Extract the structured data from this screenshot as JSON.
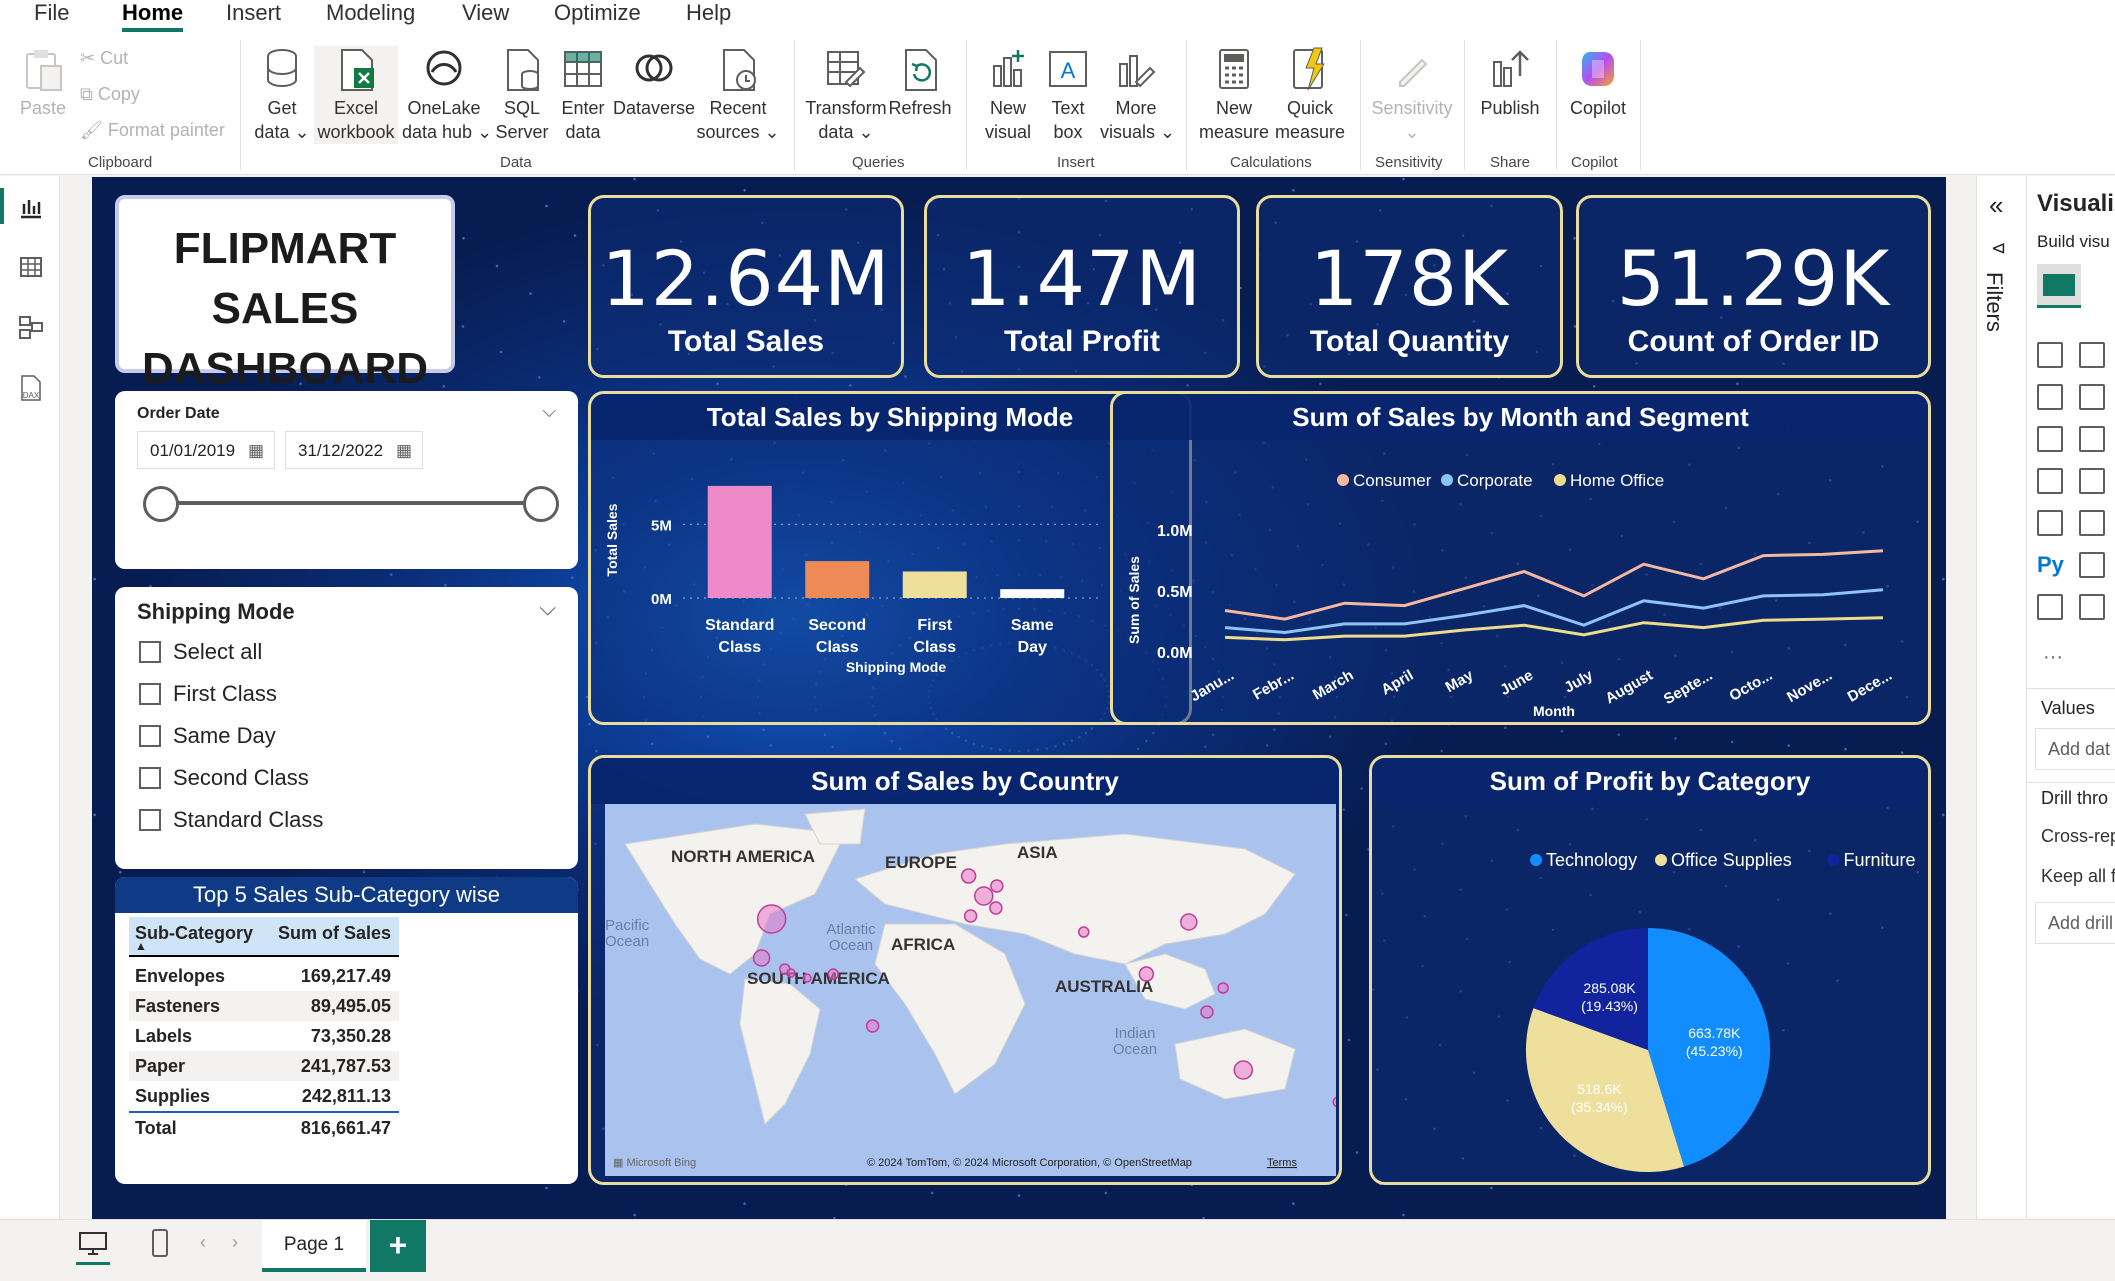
{
  "menu": {
    "tabs": [
      "File",
      "Home",
      "Insert",
      "Modeling",
      "View",
      "Optimize",
      "Help"
    ],
    "active": "Home"
  },
  "ribbon": {
    "clipboard": {
      "paste": "Paste",
      "cut": "Cut",
      "copy": "Copy",
      "format_painter": "Format painter",
      "group": "Clipboard"
    },
    "data": {
      "get_data": [
        "Get",
        "data"
      ],
      "excel": [
        "Excel",
        "workbook"
      ],
      "onelake": [
        "OneLake",
        "data hub"
      ],
      "sql": [
        "SQL",
        "Server"
      ],
      "enter": [
        "Enter",
        "data"
      ],
      "dataverse": "Dataverse",
      "recent": [
        "Recent",
        "sources"
      ],
      "group": "Data"
    },
    "queries": {
      "transform": [
        "Transform",
        "data"
      ],
      "refresh": "Refresh",
      "group": "Queries"
    },
    "insert": {
      "new_visual": [
        "New",
        "visual"
      ],
      "text_box": [
        "Text",
        "box"
      ],
      "more_visuals": [
        "More",
        "visuals"
      ],
      "group": "Insert"
    },
    "calculations": {
      "new_measure": [
        "New",
        "measure"
      ],
      "quick_measure": [
        "Quick",
        "measure"
      ],
      "group": "Calculations"
    },
    "sensitivity": {
      "label": "Sensitivity",
      "group": "Sensitivity"
    },
    "share": {
      "publish": "Publish",
      "group": "Share"
    },
    "copilot": {
      "label": "Copilot",
      "group": "Copilot"
    }
  },
  "dashboard": {
    "title_line1": "FLIPMART SALES",
    "title_line2": "DASHBOARD",
    "kpis": [
      {
        "value": "12.64M",
        "label": "Total Sales"
      },
      {
        "value": "1.47M",
        "label": "Total Profit"
      },
      {
        "value": "178K",
        "label": "Total Quantity"
      },
      {
        "value": "51.29K",
        "label": "Count of Order ID"
      }
    ],
    "order_date": {
      "title": "Order Date",
      "start": "01/01/2019",
      "end": "31/12/2022",
      "range_start_fraction": 0,
      "range_end_fraction": 1
    },
    "shipping_slicer": {
      "title": "Shipping Mode",
      "items": [
        "Select all",
        "First Class",
        "Same Day",
        "Second Class",
        "Standard Class"
      ]
    },
    "top5": {
      "title": "Top 5 Sales Sub-Category wise",
      "headers": [
        "Sub-Category",
        "Sum of Sales"
      ],
      "rows": [
        [
          "Envelopes",
          "169,217.49"
        ],
        [
          "Fasteners",
          "89,495.05"
        ],
        [
          "Labels",
          "73,350.28"
        ],
        [
          "Paper",
          "241,787.53"
        ],
        [
          "Supplies",
          "242,811.13"
        ]
      ],
      "total": [
        "Total",
        "816,661.47"
      ]
    },
    "map": {
      "title": "Sum of Sales by Country",
      "labels": {
        "north_america": "NORTH AMERICA",
        "europe": "EUROPE",
        "asia": "ASIA",
        "africa": "AFRICA",
        "south_america": "SOUTH AMERICA",
        "australia": "AUSTRALIA",
        "pacific": [
          "Pacific",
          "Ocean"
        ],
        "atlantic": [
          "Atlantic",
          "Ocean"
        ],
        "indian": [
          "Indian",
          "Ocean"
        ]
      },
      "bing": "Microsoft Bing",
      "attribution": "© 2024 TomTom, © 2024 Microsoft Corporation, © OpenStreetMap",
      "terms": "Terms"
    }
  },
  "chart_data": [
    {
      "type": "bar",
      "title": "Total Sales by Shipping Mode",
      "xlabel": "Shipping Mode",
      "ylabel": "Total Sales",
      "categories": [
        "Standard Class",
        "Second Class",
        "First Class",
        "Same Day"
      ],
      "values": [
        7.6,
        2.5,
        1.8,
        0.6
      ],
      "value_unit": "M",
      "ylim": [
        0,
        8
      ],
      "yticks": [
        "0M",
        "5M"
      ],
      "colors": [
        "#ef8ac8",
        "#ee8a56",
        "#eee09a",
        "#ffffff"
      ]
    },
    {
      "type": "line",
      "title": "Sum of Sales by Month and Segment",
      "xlabel": "Month",
      "ylabel": "Sum of Sales",
      "categories": [
        "Janu...",
        "Febr...",
        "March",
        "April",
        "May",
        "June",
        "July",
        "August",
        "Septe...",
        "Octo...",
        "Nove...",
        "Dece..."
      ],
      "yticks": [
        "0.0M",
        "0.5M",
        "1.0M"
      ],
      "ylim": [
        0,
        1.1
      ],
      "legend_position": "top",
      "series": [
        {
          "name": "Consumer",
          "color": "#f4b7a0",
          "values": [
            0.34,
            0.27,
            0.4,
            0.38,
            0.52,
            0.66,
            0.46,
            0.72,
            0.6,
            0.79,
            0.8,
            0.83
          ]
        },
        {
          "name": "Corporate",
          "color": "#8ec3f4",
          "values": [
            0.2,
            0.16,
            0.23,
            0.23,
            0.3,
            0.38,
            0.22,
            0.42,
            0.36,
            0.46,
            0.47,
            0.51
          ]
        },
        {
          "name": "Home Office",
          "color": "#eedc8c",
          "values": [
            0.12,
            0.1,
            0.13,
            0.13,
            0.18,
            0.22,
            0.14,
            0.24,
            0.2,
            0.26,
            0.27,
            0.28
          ]
        }
      ]
    },
    {
      "type": "pie",
      "title": "Sum of Profit by Category",
      "legend_position": "top",
      "categories": [
        "Technology",
        "Office Supplies",
        "Furniture"
      ],
      "values": [
        663.78,
        518.6,
        285.08
      ],
      "value_unit": "K",
      "labels": [
        "663.78K",
        "518.6K",
        "285.08K"
      ],
      "percents": [
        "(45.23%)",
        "(35.34%)",
        "(19.43%)"
      ],
      "colors": [
        "#118dff",
        "#eedf9c",
        "#12239e"
      ]
    }
  ],
  "right_panel": {
    "filters_label": "Filters",
    "viz_title": "Visualiz",
    "build": "Build visu",
    "values": "Values",
    "add_data": "Add dat",
    "drill": "Drill thro",
    "cross": "Cross-rep",
    "keep": "Keep all f",
    "add_drill": "Add drill"
  },
  "bottom": {
    "page_tab": "Page 1",
    "add": "+"
  }
}
